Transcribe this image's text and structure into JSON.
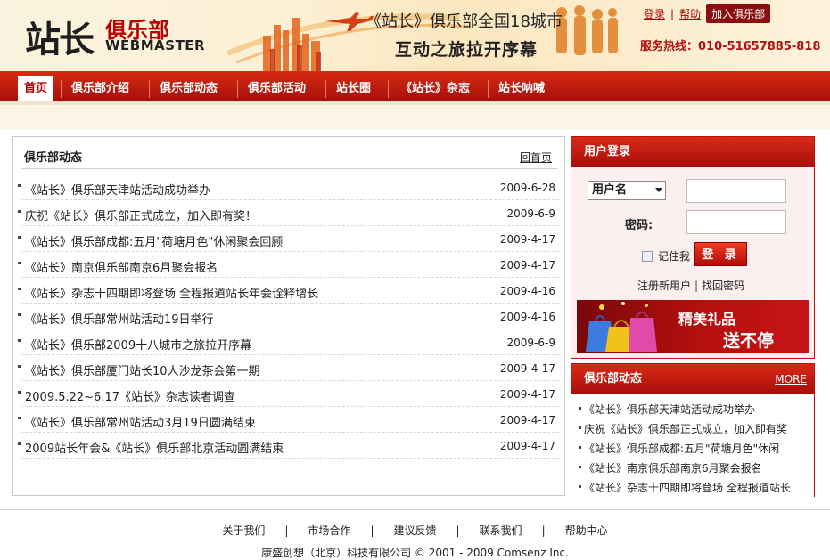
{
  "header": {
    "logo_main": "站长",
    "logo_sub": "俱乐部",
    "logo_en": "WEBMASTER",
    "banner_line1": "《站长》俱乐部全国18城市",
    "banner_line2": "互动之旅拉开序幕",
    "login_link": "登录",
    "help_link": "帮助",
    "join_button": "加入俱乐部",
    "hotline": "服务热线：010-51657885-818"
  },
  "nav": {
    "items": [
      {
        "label": "首页"
      },
      {
        "label": "俱乐部介绍"
      },
      {
        "label": "俱乐部动态"
      },
      {
        "label": "俱乐部活动"
      },
      {
        "label": "站长圈"
      },
      {
        "label": "《站长》杂志"
      },
      {
        "label": "站长呐喊"
      }
    ]
  },
  "main": {
    "title": "俱乐部动态",
    "back_link": "回首页",
    "news": [
      {
        "title": "《站长》俱乐部天津站活动成功举办",
        "date": "2009-6-28"
      },
      {
        "title": "庆祝《站长》俱乐部正式成立，加入即有奖！",
        "date": "2009-6-9"
      },
      {
        "title": "《站长》俱乐部成都:五月\"荷塘月色\"休闲聚会回顾",
        "date": "2009-4-17"
      },
      {
        "title": "《站长》南京俱乐部南京6月聚会报名",
        "date": "2009-4-17"
      },
      {
        "title": "《站长》杂志十四期即将登场 全程报道站长年会诠释增长",
        "date": "2009-4-16"
      },
      {
        "title": "《站长》俱乐部常州站活动19日举行",
        "date": "2009-4-16"
      },
      {
        "title": "《站长》俱乐部2009十八城市之旅拉开序幕",
        "date": "2009-6-9"
      },
      {
        "title": "《站长》俱乐部厦门站长10人沙龙茶会第一期",
        "date": "2009-4-17"
      },
      {
        "title": "2009.5.22~6.17《站长》杂志读者调查",
        "date": "2009-4-17"
      },
      {
        "title": "《站长》俱乐部常州站活动3月19日圆满结束",
        "date": "2009-4-17"
      },
      {
        "title": "2009站长年会&《站长》俱乐部北京活动圆满结束",
        "date": "2009-4-17"
      }
    ]
  },
  "login": {
    "title": "用户登录",
    "user_select": "用户名",
    "password_label": "密码:",
    "remember": "记住我",
    "submit": "登 录",
    "register": "注册新用户",
    "forgot": "找回密码",
    "gift_line1": "精美礼品",
    "gift_line2": "送不停"
  },
  "side": {
    "title": "俱乐部动态",
    "more": "MORE",
    "news": [
      {
        "title": "《站长》俱乐部天津站活动成功举办"
      },
      {
        "title": "庆祝《站长》俱乐部正式成立，加入即有奖"
      },
      {
        "title": "《站长》俱乐部成都:五月\"荷塘月色\"休闲"
      },
      {
        "title": "《站长》南京俱乐部南京6月聚会报名"
      },
      {
        "title": "《站长》杂志十四期即将登场 全程报道站长"
      }
    ]
  },
  "footer": {
    "links": [
      "关于我们",
      "市场合作",
      "建议反馈",
      "联系我们",
      "帮助中心"
    ],
    "copyright": "康盛创想（北京）科技有限公司 © 2001 - 2009 Comsenz Inc."
  }
}
